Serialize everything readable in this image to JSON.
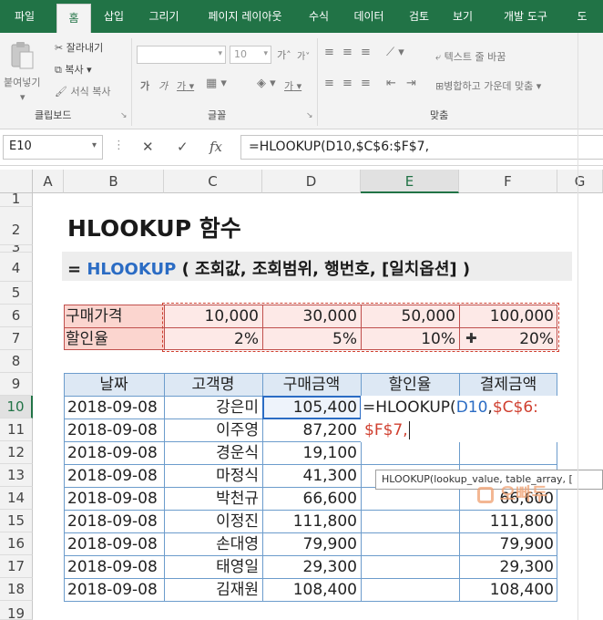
{
  "ribbon_tabs": [
    "파일",
    "홈",
    "삽입",
    "그리기",
    "페이지 레이아웃",
    "수식",
    "데이터",
    "검토",
    "보기",
    "개발 도구",
    "도"
  ],
  "clipboard": {
    "paste": "붙여넣기",
    "cut": "잘라내기",
    "copy": "복사",
    "format_painter": "서식 복사",
    "group": "클립보드"
  },
  "font": {
    "size": "10",
    "grow": "가",
    "shrink": "가",
    "bold": "가",
    "italic": "가",
    "underline": "가",
    "color_glyph": "가",
    "group": "글꼴"
  },
  "alignment": {
    "wrap": "텍스트 줄 바꿈",
    "merge": "병합하고 가운데 맞춤",
    "group": "맞춤"
  },
  "formula_bar": {
    "name_box": "E10",
    "fx": "fx",
    "formula": "=HLOOKUP(D10,$C$6:$F$7,"
  },
  "columns": [
    "A",
    "B",
    "C",
    "D",
    "E",
    "F",
    "G"
  ],
  "rows": [
    "1",
    "2",
    "3",
    "4",
    "5",
    "6",
    "7",
    "8",
    "9",
    "10",
    "11",
    "12",
    "13",
    "14",
    "15",
    "16",
    "17",
    "18",
    "19"
  ],
  "sheet": {
    "title": "HLOOKUP 함수",
    "syntax_prefix": "= ",
    "syntax_fn": "HLOOKUP",
    "syntax_args": " ( 조회값, 조회범위, 행번호, [일치옵션] )",
    "lookup_row6": [
      "구매가격",
      "10,000",
      "30,000",
      "50,000",
      "100,000"
    ],
    "lookup_row7": [
      "할인율",
      "2%",
      "5%",
      "10%",
      "20%"
    ],
    "headers": [
      "날짜",
      "고객명",
      "구매금액",
      "할인율",
      "결제금액"
    ],
    "rows": [
      [
        "2018-09-08",
        "강은미",
        "105,400",
        "",
        ""
      ],
      [
        "2018-09-08",
        "이주영",
        "87,200",
        "",
        ""
      ],
      [
        "2018-09-08",
        "경운식",
        "19,100",
        "",
        ""
      ],
      [
        "2018-09-08",
        "마정식",
        "41,300",
        "",
        ""
      ],
      [
        "2018-09-08",
        "박천규",
        "66,600",
        "",
        "66,600"
      ],
      [
        "2018-09-08",
        "이정진",
        "111,800",
        "",
        "111,800"
      ],
      [
        "2018-09-08",
        "손대영",
        "79,900",
        "",
        "79,900"
      ],
      [
        "2018-09-08",
        "태영일",
        "29,300",
        "",
        "29,300"
      ],
      [
        "2018-09-08",
        "김재원",
        "108,400",
        "",
        "108,400"
      ]
    ],
    "editing": {
      "part1": "=HLOOKUP(",
      "part2": "D10",
      "part3": ",",
      "part4": "$C$6:",
      "part5": "$F$7,"
    },
    "tooltip": "HLOOKUP(lookup_value, table_array, [",
    "watermark": "오빠두"
  },
  "colors": {
    "excel_green": "#217346",
    "table_border": "#6c9ccc",
    "lookup_fill": "#fde9e7",
    "lookup_border": "#c0504d",
    "ref_blue": "#2b6cc4",
    "ref_red": "#d04030"
  }
}
